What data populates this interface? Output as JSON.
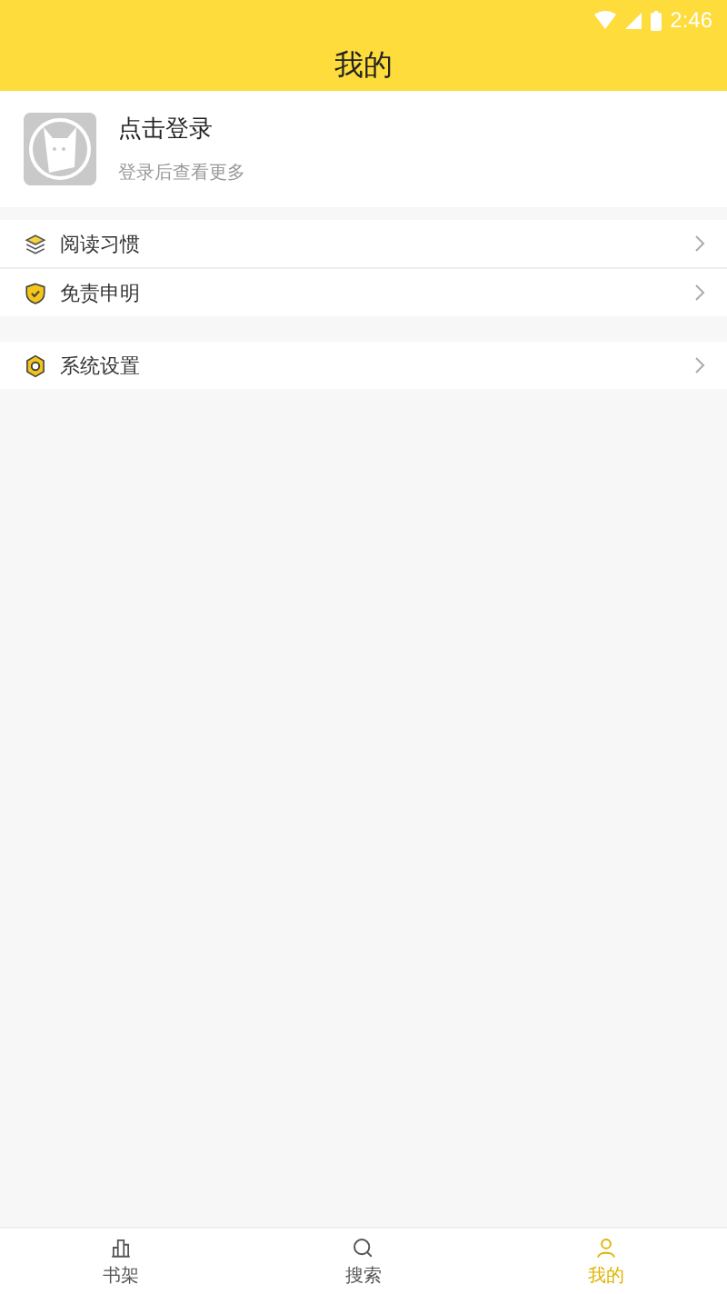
{
  "status_bar": {
    "time": "2:46"
  },
  "header": {
    "title": "我的"
  },
  "profile": {
    "name": "点击登录",
    "hint": "登录后查看更多"
  },
  "menu_groups": [
    {
      "items": [
        {
          "kind": "layers",
          "label": "阅读习惯"
        },
        {
          "kind": "shield",
          "label": "免责申明"
        }
      ]
    },
    {
      "items": [
        {
          "kind": "gear",
          "label": "系统设置"
        }
      ]
    }
  ],
  "tabs": [
    {
      "kind": "shelf",
      "label": "书架",
      "selected": false
    },
    {
      "kind": "search",
      "label": "搜索",
      "selected": false
    },
    {
      "kind": "user",
      "label": "我的",
      "selected": true
    }
  ]
}
